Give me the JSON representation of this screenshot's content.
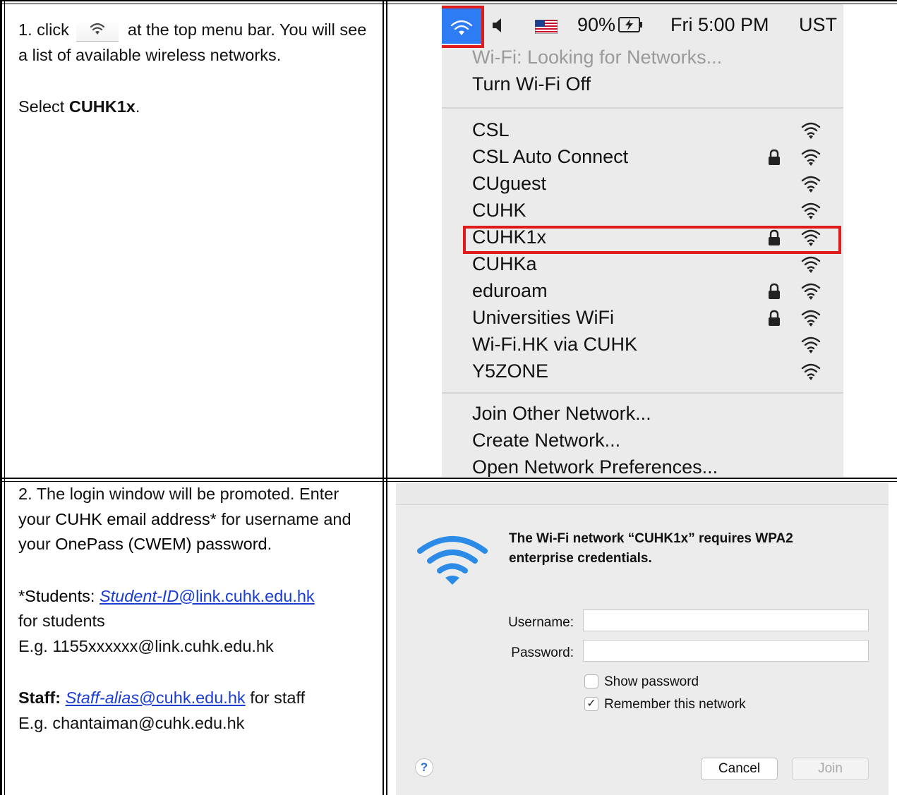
{
  "step1": {
    "number": "1.",
    "click_word": "click",
    "after_icon": "at the top menu bar. You will see a list of available wireless networks.",
    "select_prefix": "Select ",
    "select_target": "CUHK1x",
    "select_suffix": "."
  },
  "menu": {
    "menubar": {
      "battery": "90%",
      "clock": "Fri 5:00 PM",
      "user": "UST"
    },
    "status": "Wi-Fi: Looking for Networks...",
    "toggle": "Turn Wi-Fi Off",
    "networks": [
      {
        "name": "CSL",
        "locked": false
      },
      {
        "name": "CSL Auto Connect",
        "locked": true
      },
      {
        "name": "CUguest",
        "locked": false
      },
      {
        "name": "CUHK",
        "locked": false
      },
      {
        "name": "CUHK1x",
        "locked": true,
        "highlighted": true
      },
      {
        "name": "CUHKa",
        "locked": false
      },
      {
        "name": "eduroam",
        "locked": true
      },
      {
        "name": "Universities WiFi",
        "locked": true
      },
      {
        "name": "Wi-Fi.HK via CUHK",
        "locked": false
      },
      {
        "name": "Y5ZONE",
        "locked": false
      }
    ],
    "actions": [
      "Join Other Network...",
      "Create Network...",
      "Open Network Preferences..."
    ]
  },
  "step2": {
    "intro_1": "2. The login window will be promoted. Enter your ",
    "email_term": "CUHK email address*",
    "intro_2": " for username and your ",
    "password_term": "OnePass (CWEM) password",
    "intro_3": ".",
    "students_label": "*Students: ",
    "students_id": "Student-ID",
    "students_domain": "@link.cuhk.edu.hk",
    "students_suffix": "for students",
    "students_example": "E.g. 1155xxxxxx@link.cuhk.edu.hk",
    "staff_label": "Staff: ",
    "staff_alias": "Staff-alias",
    "staff_domain": "@cuhk.edu.hk",
    "staff_suffix": " for staff",
    "staff_example": "E.g. chantaiman@cuhk.edu.hk"
  },
  "dialog": {
    "message": "The Wi-Fi network “CUHK1x” requires WPA2 enterprise credentials.",
    "username_label": "Username:",
    "password_label": "Password:",
    "username_value": "",
    "password_value": "",
    "show_password": "Show password",
    "show_password_checked": false,
    "remember": "Remember this network",
    "remember_checked": true,
    "cancel": "Cancel",
    "join": "Join",
    "help": "?"
  },
  "colors": {
    "highlight_box": "#e01b1b",
    "wifi_blue": "#2d7cf3",
    "link": "#1a3cd4"
  }
}
